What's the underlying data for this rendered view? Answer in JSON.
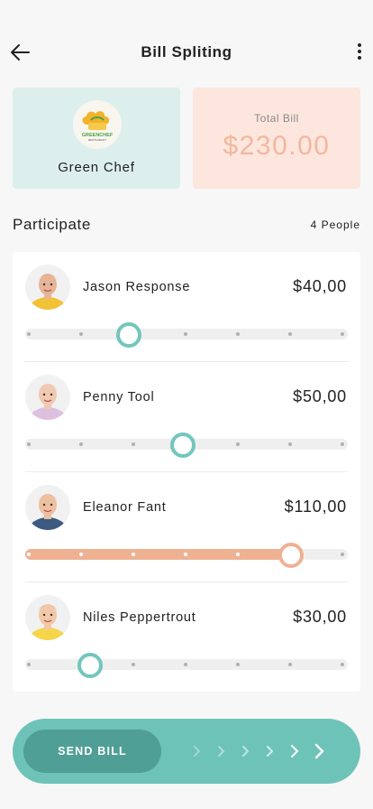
{
  "header": {
    "title": "Bill Spliting"
  },
  "restaurant": {
    "name": "Green Chef",
    "logo_text": "GREENCHEF",
    "logo_subtext": "RESTAURANT"
  },
  "total": {
    "label": "Total Bill",
    "value": "$230.00"
  },
  "participants_section": {
    "title": "Participate",
    "count_label": "4 People",
    "participants": [
      {
        "name": "Jason Response",
        "amount": "$40,00",
        "share": 0.32,
        "hair": "#c8442c",
        "shirt": "#f2c236",
        "skin": "#e7b497"
      },
      {
        "name": "Penny Tool",
        "amount": "$50,00",
        "share": 0.49,
        "hair": "#b88058",
        "shirt": "#ddc0df",
        "skin": "#f0c9b0"
      },
      {
        "name": "Eleanor Fant",
        "amount": "$110,00",
        "share": 0.824,
        "hair": "#d8463f",
        "shirt": "#3d5a80",
        "skin": "#eebfa0"
      },
      {
        "name": "Niles Peppertrout",
        "amount": "$30,00",
        "share": 0.2,
        "hair": "#2a1d18",
        "shirt": "#f5d64a",
        "skin": "#f2c8a8"
      }
    ]
  },
  "footer": {
    "send_label": "SEND BILL"
  },
  "colors": {
    "teal": "#72c6bd",
    "teal_dark": "#4f9f96",
    "orange": "#eeb293",
    "mint_card": "#dcefed",
    "peach_card": "#fde6dd"
  }
}
